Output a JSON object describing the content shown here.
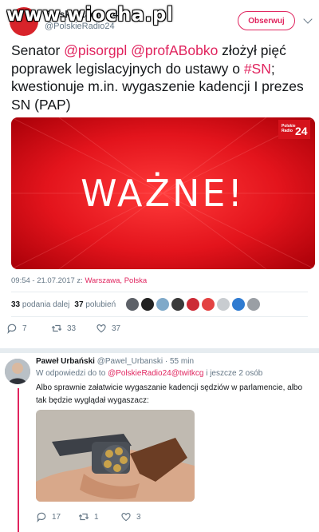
{
  "watermark": "www.wiocha.pl",
  "account": {
    "name": "PolskieRadio 24",
    "handle": "@PolskieRadio24",
    "follow_label": "Obserwuj",
    "brand_color": "#e0245e"
  },
  "tweet": {
    "text_lead": "Senator ",
    "mention1": "@pisorgpl",
    "mention2": "@profABobko",
    "text_mid": " złożył pięć poprawek legislacyjnych do ustawy o ",
    "hashtag": "#SN",
    "text_tail": "; kwestionuje m.in. wygaszenie kadencji I prezes SN (PAP)",
    "media": {
      "headline": "WAŻNE!",
      "badge_line1": "Polskie",
      "badge_line2": "Radio",
      "badge_num": "24"
    },
    "time": "09:54 - 21.07.2017 z: ",
    "location": "Warszawa, Polska",
    "retweets_count": "33",
    "retweets_label": "podania dalej",
    "likes_count": "37",
    "likes_label": "polubień",
    "likers_colors": [
      "#5d6168",
      "#222",
      "#7fa9c9",
      "#3a3a3a",
      "#cc2b36",
      "#e34343",
      "#c8ccd0",
      "#2f7bd1",
      "#9a9fa5"
    ],
    "actions": {
      "reply_count": "7",
      "retweet_count": "33",
      "like_count": "37"
    }
  },
  "reply": {
    "name": "Paweł Urbański",
    "handle": "@Pawel_Urbanski · 55 min",
    "reply_to_prefix": "W odpowiedzi do to ",
    "reply_to_mention": "@PolskieRadio24@twitkcg",
    "reply_to_suffix": " i jeszcze 2 osób",
    "text": "Albo sprawnie załatwicie wygaszanie kadencji sędziów w parlamencie, albo tak będzie wyglądał wygaszacz:",
    "actions": {
      "reply_count": "17",
      "retweet_count": "1",
      "like_count": "3"
    }
  }
}
